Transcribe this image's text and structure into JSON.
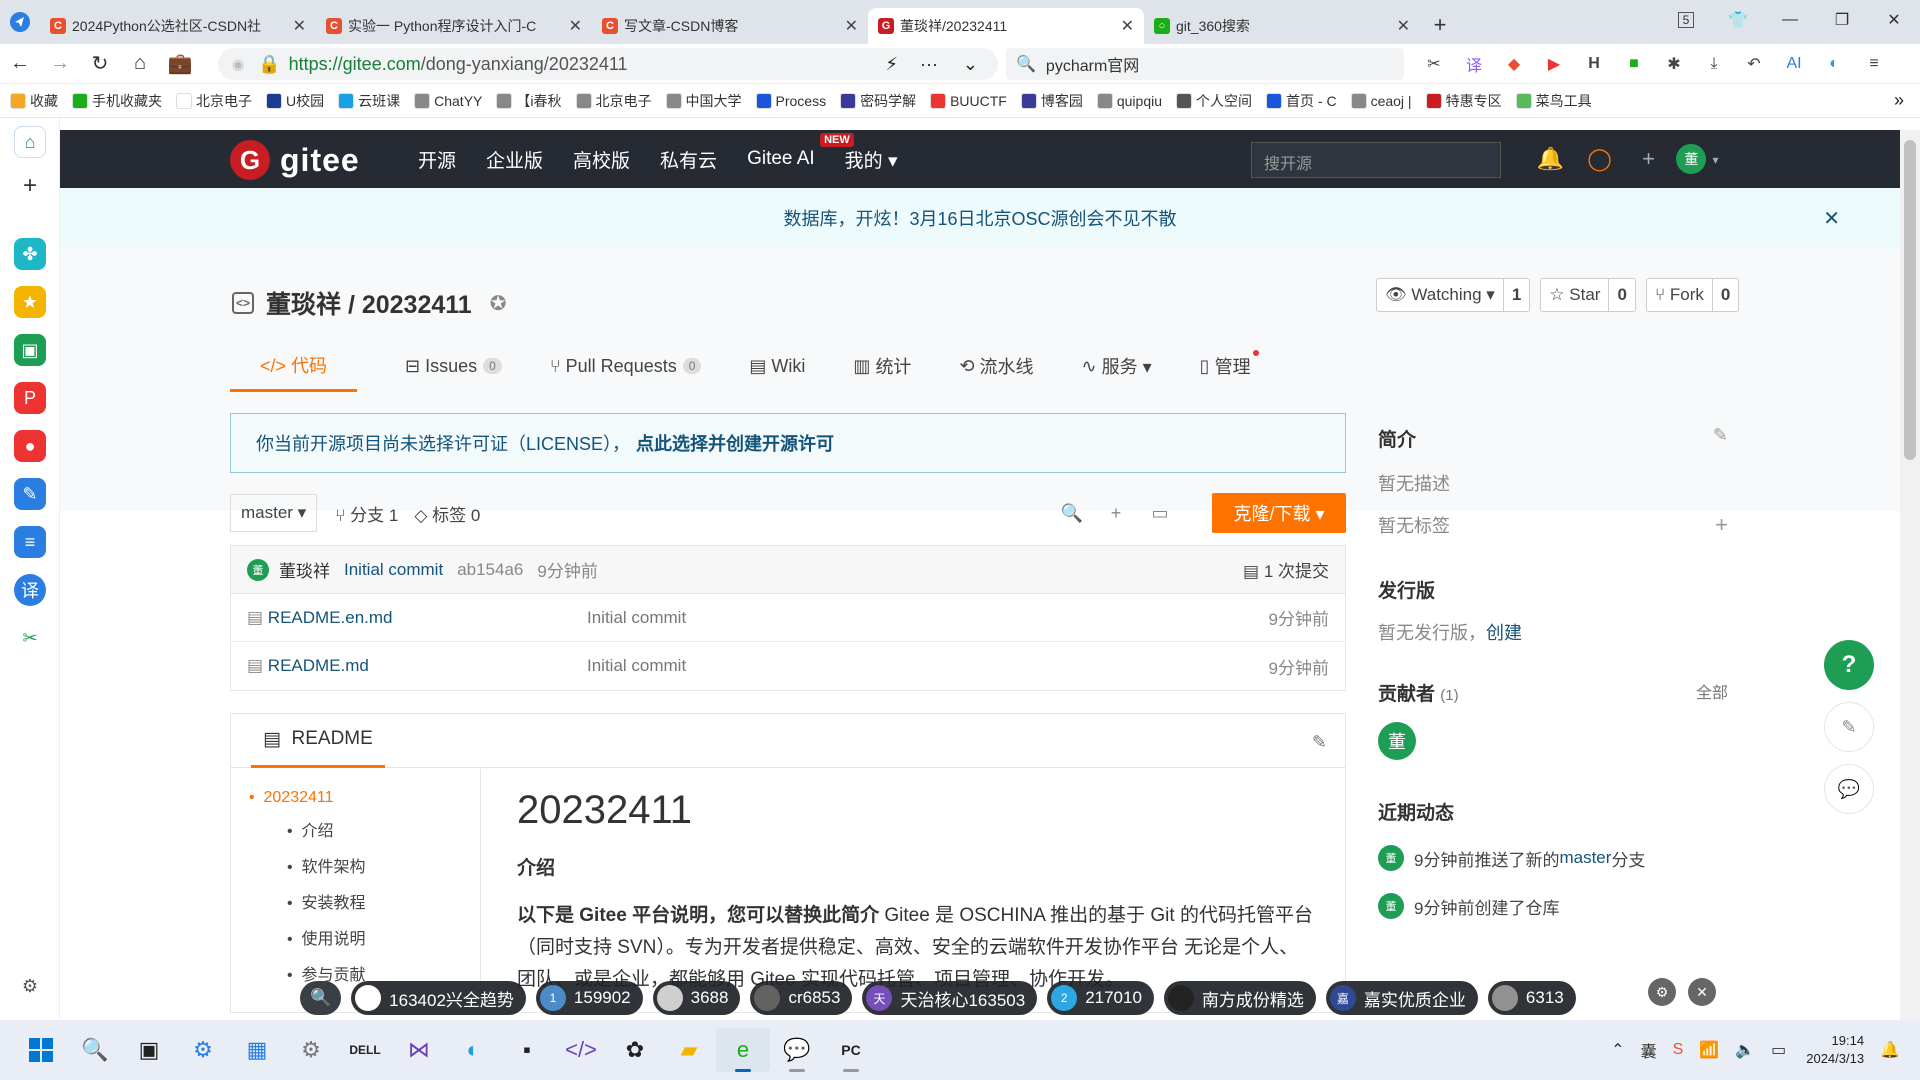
{
  "browser": {
    "tabs": [
      {
        "title": "2024Python公选社区-CSDN社",
        "color": "#e8512f",
        "glyph": "C",
        "active": false
      },
      {
        "title": "实验一 Python程序设计入门-C",
        "color": "#e8512f",
        "glyph": "C",
        "active": false
      },
      {
        "title": "写文章-CSDN博客",
        "color": "#e8512f",
        "glyph": "C",
        "active": false
      },
      {
        "title": "董琰祥/20232411",
        "color": "#c71d23",
        "glyph": "G",
        "active": true
      },
      {
        "title": "git_360搜索",
        "color": "#1aad19",
        "glyph": "○",
        "active": false
      }
    ],
    "tab_count": "5",
    "url_domain": "https://gitee.com",
    "url_path": "/dong-yanxiang/20232411",
    "search_text": "pycharm官网",
    "bookmarks": [
      {
        "label": "收藏",
        "color": "#f5a623"
      },
      {
        "label": "手机收藏夹",
        "color": "#1aad19"
      },
      {
        "label": "北京电子",
        "color": "#ffffff"
      },
      {
        "label": "U校园",
        "color": "#1a3d8f"
      },
      {
        "label": "云班课",
        "color": "#1aa1e1"
      },
      {
        "label": "ChatYY",
        "color": "#888888"
      },
      {
        "label": "【i春秋",
        "color": "#888888"
      },
      {
        "label": "北京电子",
        "color": "#888888"
      },
      {
        "label": "中国大学",
        "color": "#888888"
      },
      {
        "label": "Process",
        "color": "#1a56db"
      },
      {
        "label": "密码学解",
        "color": "#3a3a9a"
      },
      {
        "label": "BUUCTF",
        "color": "#e33"
      },
      {
        "label": "博客园",
        "color": "#3a3a9a"
      },
      {
        "label": "quipqiu",
        "color": "#888888"
      },
      {
        "label": "个人空间",
        "color": "#555555"
      },
      {
        "label": "首页 - C",
        "color": "#1a56db"
      },
      {
        "label": "ceaoj |",
        "color": "#888888"
      },
      {
        "label": "特惠专区",
        "color": "#c71d23"
      },
      {
        "label": "菜鸟工具",
        "color": "#5cb85c"
      }
    ]
  },
  "gitee": {
    "logo_text": "gitee",
    "nav": [
      "开源",
      "企业版",
      "高校版",
      "私有云",
      "Gitee AI",
      "我的 ▾"
    ],
    "new_badge": "NEW",
    "search_placeholder": "搜开源",
    "avatar": "董",
    "notice": "数据库，开炫！3月16日北京OSC源创会不见不散",
    "project": {
      "title": "董琰祥 / 20232411",
      "watching_label": "Watching ▾",
      "watching_count": "1",
      "star_label": "Star",
      "star_count": "0",
      "fork_label": "Fork",
      "fork_count": "0"
    },
    "tabs": [
      {
        "label": "</> 代码",
        "count": ""
      },
      {
        "label": "Issues",
        "count": "0"
      },
      {
        "label": "Pull Requests",
        "count": "0"
      },
      {
        "label": "Wiki",
        "count": ""
      },
      {
        "label": "统计",
        "count": ""
      },
      {
        "label": "流水线",
        "count": ""
      },
      {
        "label": "服务 ▾",
        "count": ""
      },
      {
        "label": "管理",
        "count": ""
      }
    ],
    "license_text": "你当前开源项目尚未选择许可证（LICENSE），",
    "license_link": "点此选择并创建开源许可",
    "branch": "master ▾",
    "branches": "分支 1",
    "tags": "标签 0",
    "clone_label": "克隆/下载 ▾",
    "commit": {
      "author": "董琰祥",
      "message": "Initial commit",
      "sha": "ab154a6",
      "time": "9分钟前",
      "total": "1 次提交"
    },
    "files": [
      {
        "name": "README.en.md",
        "msg": "Initial commit",
        "time": "9分钟前"
      },
      {
        "name": "README.md",
        "msg": "Initial commit",
        "time": "9分钟前"
      }
    ],
    "readme": {
      "tab": "README",
      "toc": [
        "20232411",
        "介绍",
        "软件架构",
        "安装教程",
        "使用说明",
        "参与贡献"
      ],
      "h1": "20232411",
      "h3": "介绍",
      "para_bold": "以下是 Gitee 平台说明，您可以替换此简介",
      "para": " Gitee 是 OSCHINA 推出的基于 Git 的代码托管平台（同时支持 SVN）。专为开发者提供稳定、高效、安全的云端软件开发协作平台 无论是个人、团队、或是企业，都能够用 Gitee 实现代码托管、项目管理、协作开发。"
    },
    "side": {
      "intro_title": "简介",
      "intro_desc": "暂无描述",
      "intro_tags": "暂无标签",
      "release_title": "发行版",
      "release_desc": "暂无发行版，",
      "release_link": "创建",
      "contrib_title": "贡献者",
      "contrib_count": "(1)",
      "contrib_all": "全部",
      "activity_title": "近期动态",
      "activity": [
        {
          "pre": "9分钟前推送了新的 ",
          "link": "master",
          "post": " 分支"
        },
        {
          "pre": "9分钟前创建了仓库",
          "link": "",
          "post": ""
        }
      ]
    }
  },
  "ticker": [
    {
      "label": "163402兴全趋势",
      "badge": "",
      "color": "#ffffff"
    },
    {
      "label": "159902",
      "badge": "1",
      "color": "#3b82c4"
    },
    {
      "label": "3688",
      "badge": "",
      "color": "#cccccc"
    },
    {
      "label": "cr6853",
      "badge": "",
      "color": "#555555"
    },
    {
      "label": "天治核心163503",
      "badge": "天",
      "color": "#6a3fb5"
    },
    {
      "label": "217010",
      "badge": "2",
      "color": "#1aa1e1"
    },
    {
      "label": "南方成份精选",
      "badge": "",
      "color": "#111111"
    },
    {
      "label": "嘉实优质企业",
      "badge": "嘉",
      "color": "#1e3a8a"
    },
    {
      "label": "6313",
      "badge": "",
      "color": "#888888"
    }
  ],
  "taskbar": {
    "time": "19:14",
    "date": "2024/3/13"
  }
}
